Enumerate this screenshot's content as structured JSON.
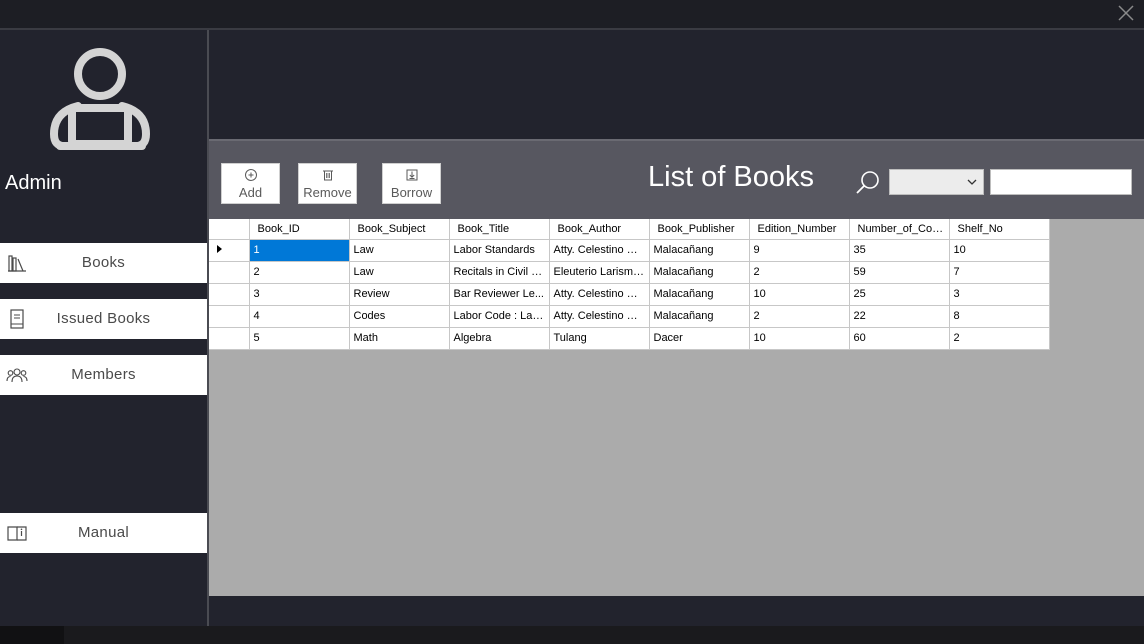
{
  "sidebar": {
    "user_label": "Admin",
    "nav": [
      {
        "label": "Books",
        "icon": "bookshelf-icon"
      },
      {
        "label": "Issued Books",
        "icon": "notebook-icon"
      },
      {
        "label": "Members",
        "icon": "members-icon"
      },
      {
        "label": "Manual",
        "icon": "manual-icon"
      }
    ]
  },
  "toolbar": {
    "add_label": "Add",
    "remove_label": "Remove",
    "borrow_label": "Borrow",
    "title": "List of Books",
    "filter_value": "",
    "search_value": ""
  },
  "grid": {
    "columns": [
      "Book_ID",
      "Book_Subject",
      "Book_Title",
      "Book_Author",
      "Book_Publisher",
      "Edition_Number",
      "Number_of_Copies",
      "Shelf_No"
    ],
    "rows": [
      [
        "1",
        "Law",
        "Labor Standards",
        "Atty. Celestino Ca...",
        "Malacañang",
        "9",
        "35",
        "10"
      ],
      [
        "2",
        "Law",
        "Recitals in Civil P...",
        "Eleuterio Larisma ...",
        "Malacañang",
        "2",
        "59",
        "7"
      ],
      [
        "3",
        "Review",
        "Bar Reviewer Le...",
        "Atty. Celestino Ca...",
        "Malacañang",
        "10",
        "25",
        "3"
      ],
      [
        "4",
        "Codes",
        "Labor Code : Lab...",
        "Atty. Celestino Ca...",
        "Malacañang",
        "2",
        "22",
        "8"
      ],
      [
        "5",
        "Math",
        "Algebra",
        "Tulang",
        "Dacer",
        "10",
        "60",
        "2"
      ]
    ],
    "selected_row": 0
  },
  "colors": {
    "background": "#22232d",
    "toolbar": "#575760",
    "selection": "#0078d7",
    "grid_empty": "#ababab"
  }
}
